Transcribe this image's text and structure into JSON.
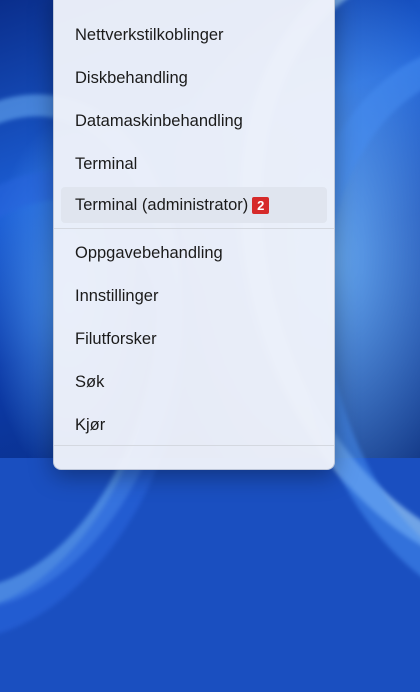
{
  "menu": {
    "items": [
      {
        "label": "Nettverkstilkoblinger"
      },
      {
        "label": "Diskbehandling"
      },
      {
        "label": "Datamaskinbehandling"
      },
      {
        "label": "Terminal"
      },
      {
        "label": "Terminal (administrator)",
        "badge": "2"
      },
      {
        "label": "Oppgavebehandling"
      },
      {
        "label": "Innstillinger"
      },
      {
        "label": "Filutforsker"
      },
      {
        "label": "Søk"
      },
      {
        "label": "Kjør"
      }
    ]
  },
  "colors": {
    "menu_background": "#eef2fa",
    "hover_background": "#e0e5ef",
    "badge": "#d62a2a",
    "wallpaper_accent": "#1c5fd6"
  }
}
